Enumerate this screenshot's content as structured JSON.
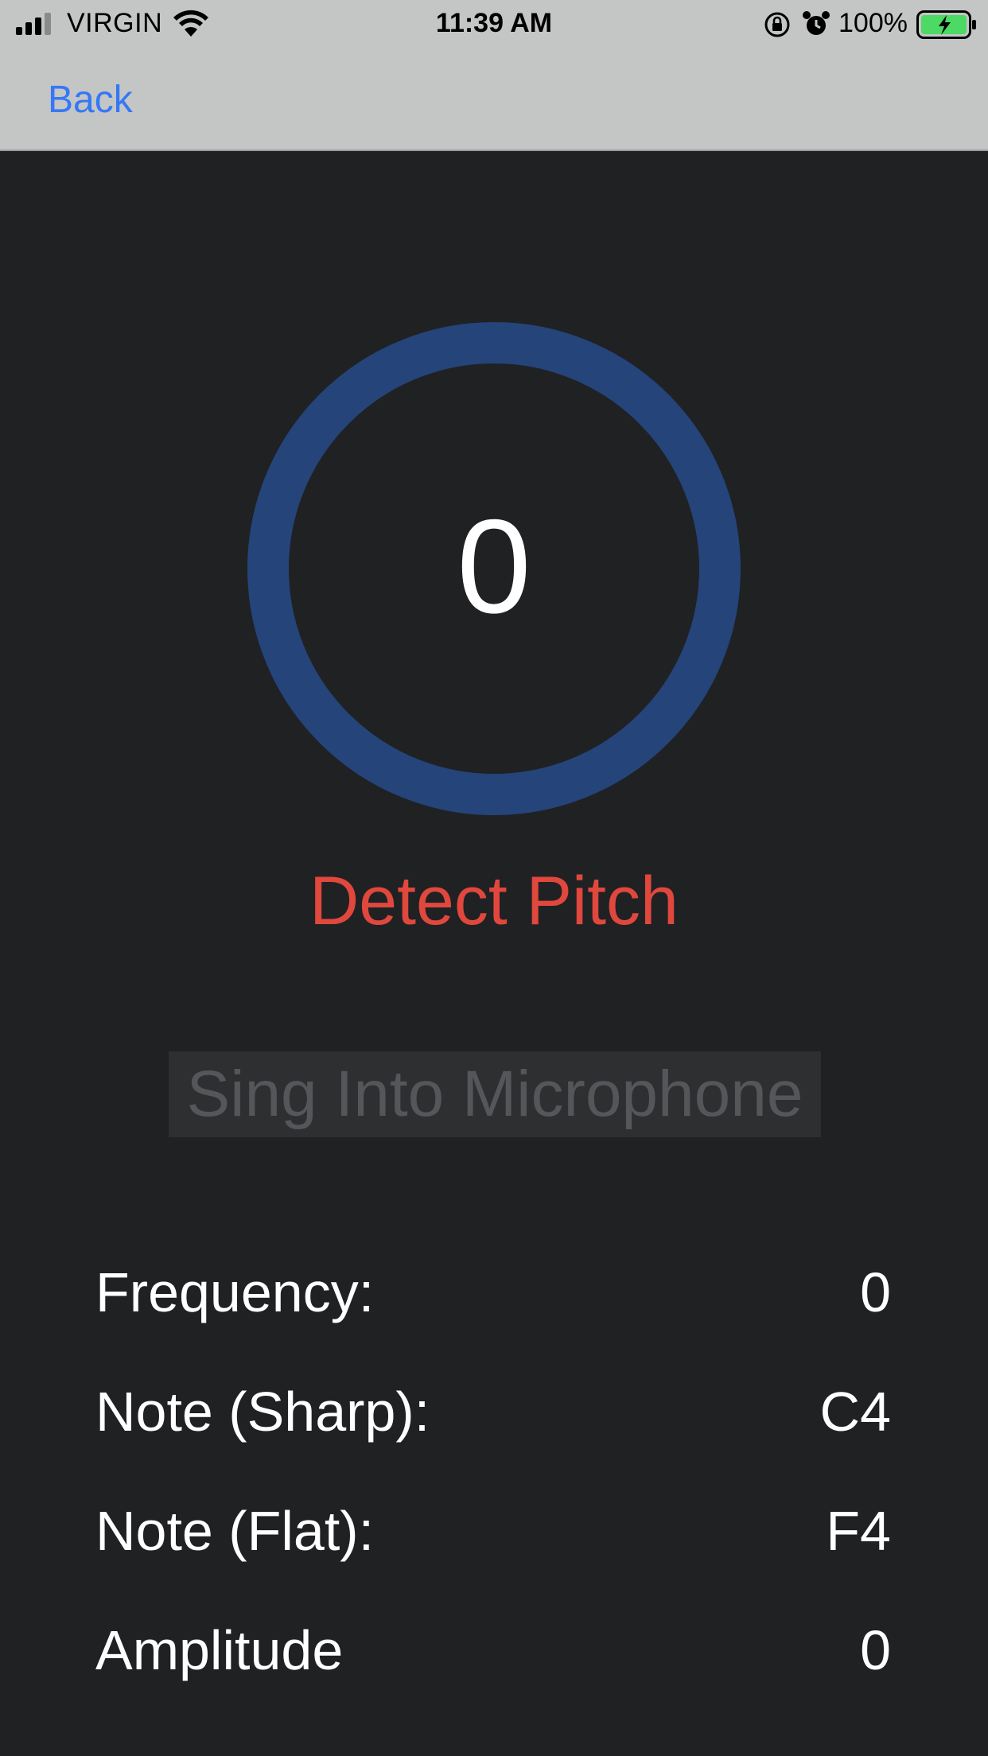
{
  "status_bar": {
    "carrier": "VIRGIN",
    "time": "11:39 AM",
    "battery": "100%",
    "icons": [
      "signal-icon",
      "wifi-icon",
      "rotation-lock-icon",
      "alarm-icon",
      "battery-charging-icon"
    ]
  },
  "nav": {
    "back_label": "Back"
  },
  "pitch": {
    "ring_value": "0",
    "ring_color": "#24447a"
  },
  "detect_button": {
    "label": "Detect Pitch",
    "color": "#e0473d"
  },
  "instruction": {
    "text": "Sing Into Microphone"
  },
  "readouts": [
    {
      "label": "Frequency:",
      "value": "0"
    },
    {
      "label": "Note (Sharp):",
      "value": "C4"
    },
    {
      "label": "Note (Flat):",
      "value": "F4"
    },
    {
      "label": "Amplitude",
      "value": "0"
    }
  ]
}
